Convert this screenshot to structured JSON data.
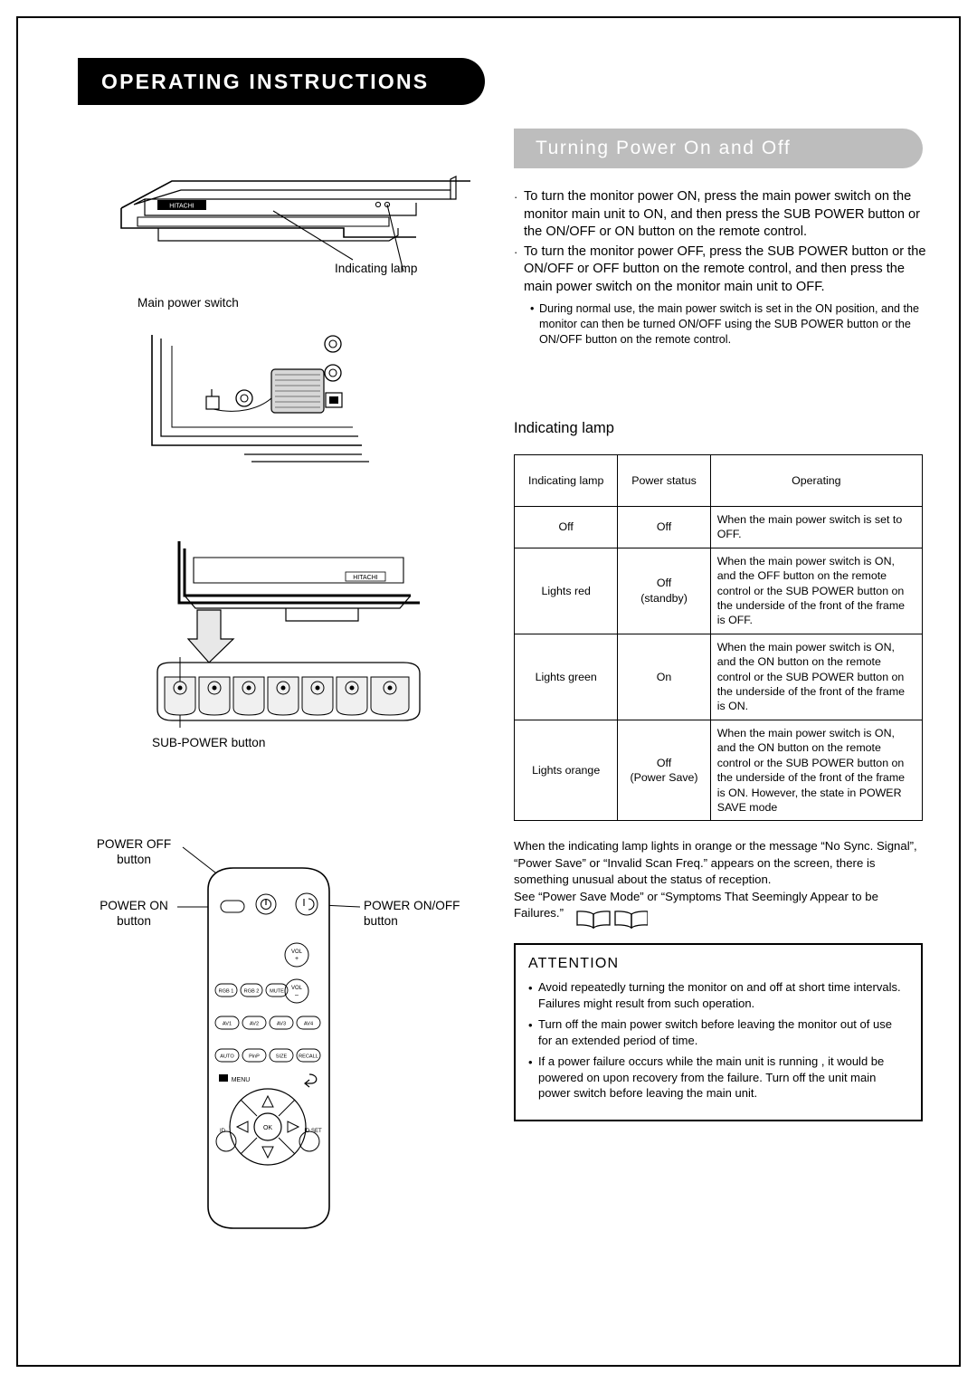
{
  "header": {
    "title": "OPERATING INSTRUCTIONS"
  },
  "section": {
    "title": "Turning Power On and Off"
  },
  "intro": {
    "bullets": [
      "To turn the monitor power ON, press the main power switch on the monitor main unit to ON, and then press the SUB POWER button or the ON/OFF or ON button on the remote control.",
      "To turn the monitor power OFF, press the SUB POWER button or the ON/OFF or OFF button on the remote control, and then press the main power switch on the monitor main unit to OFF."
    ],
    "note": "During normal use, the main power switch is set in the ON position, and the monitor can then be turned ON/OFF using the SUB POWER button or the ON/OFF button on the remote control."
  },
  "table": {
    "heading": "Indicating lamp",
    "headers": [
      "Indicating lamp",
      "Power status",
      "Operating"
    ],
    "rows": [
      {
        "lamp": "Off",
        "status": "Off",
        "operating": "When the main power switch is set to OFF."
      },
      {
        "lamp": "Lights red",
        "status": "Off\n(standby)",
        "operating": "When the main power switch is ON, and the OFF button on the remote control or the SUB POWER button on the underside of the front of the frame is OFF."
      },
      {
        "lamp": "Lights green",
        "status": "On",
        "operating": "When the main power switch is ON, and the ON button on the remote control or the SUB POWER button on the underside of the front of the frame is ON."
      },
      {
        "lamp": "Lights  orange",
        "status": "Off\n(Power Save)",
        "operating": "When the main power switch is ON, and the ON button on the remote control or the SUB POWER button on the underside of the front of the frame is ON. However, the state in POWER SAVE mode"
      }
    ]
  },
  "after_table": "When the indicating lamp lights in orange or the message “No Sync. Signal”, “Power Save” or “Invalid Scan Freq.” appears on the screen, there is something unusual about the status of reception.\nSee “Power Save Mode” or “Symptoms That Seemingly Appear to be Failures.”",
  "attention": {
    "title": "ATTENTION",
    "bullets": [
      "Avoid repeatedly turning the monitor on and off at short time intervals. Failures might result from such operation.",
      "Turn off the main power switch before leaving the monitor out of use for an extended period of time.",
      "If a power failure occurs while the main unit is running , it would be powered on upon recovery from the failure. Turn off the unit main power switch before leaving the main unit."
    ]
  },
  "diagram": {
    "indicating_lamp_label": "Indicating lamp",
    "main_power_switch_label": "Main power switch",
    "sub_power_button_label": "SUB-POWER button",
    "brand": "HITACHI",
    "power_off_label": "POWER OFF\nbutton",
    "power_on_label": "POWER ON\nbutton",
    "power_onoff_label": "POWER ON/OFF\nbutton",
    "remote_keys": {
      "vol_up": "VOL +",
      "vol_down": "VOL −",
      "row1": [
        "RGB 1",
        "RGB 2",
        "MUTE"
      ],
      "row2": [
        "AV1",
        "AV2",
        "AV3",
        "AV4"
      ],
      "row3": [
        "AUTO",
        "PinP",
        "SIZE",
        "RECALL"
      ],
      "menu": "MENU",
      "ok": "OK",
      "id": "ID",
      "id_set": "ID SET"
    }
  }
}
